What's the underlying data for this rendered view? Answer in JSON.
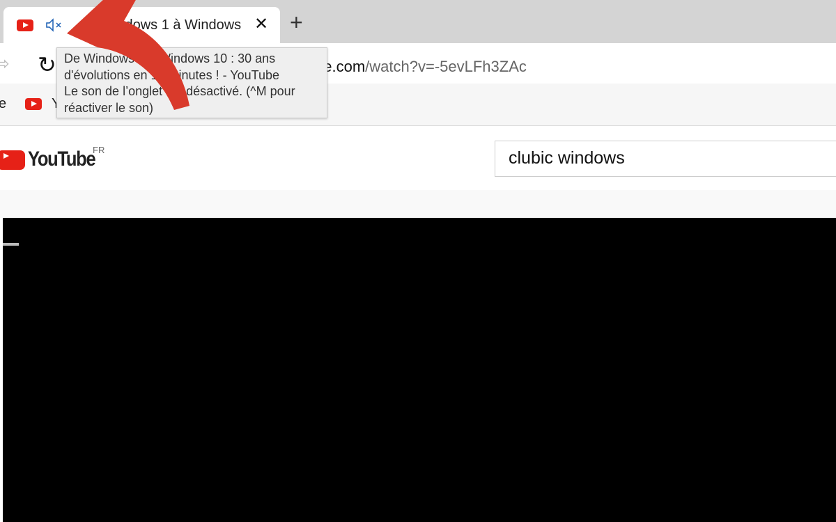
{
  "tab": {
    "title": "De Windows 1 à Windows 10 : 30 ans d'évolutions en 10 minutes ! - YouTube",
    "visible_title": "Windows 1 à Windows",
    "favicon": "youtube-icon",
    "mute_icon": "speaker-muted-icon",
    "close": "✕"
  },
  "new_tab": "+",
  "toolbar": {
    "url_host": "be.com",
    "url_path": "/watch?v=-5evLFh3ZAc",
    "reload": "↻"
  },
  "bookmarks": {
    "partial_left": "e",
    "partial_item": "Y"
  },
  "tooltip": {
    "line1": "De Windows 1 à Windows 10 : 30 ans",
    "line2": "d'évolutions en 10 minutes ! - YouTube",
    "line3": "Le son de l’onglet est désactivé. (^M pour",
    "line4": "réactiver le son)"
  },
  "youtube": {
    "logo_text": "YouTube",
    "region": "FR",
    "search_value": "clubic windows"
  },
  "colors": {
    "youtube_red": "#e62117",
    "arrow_red": "#d93a2b",
    "mute_blue": "#1a5fb4"
  }
}
